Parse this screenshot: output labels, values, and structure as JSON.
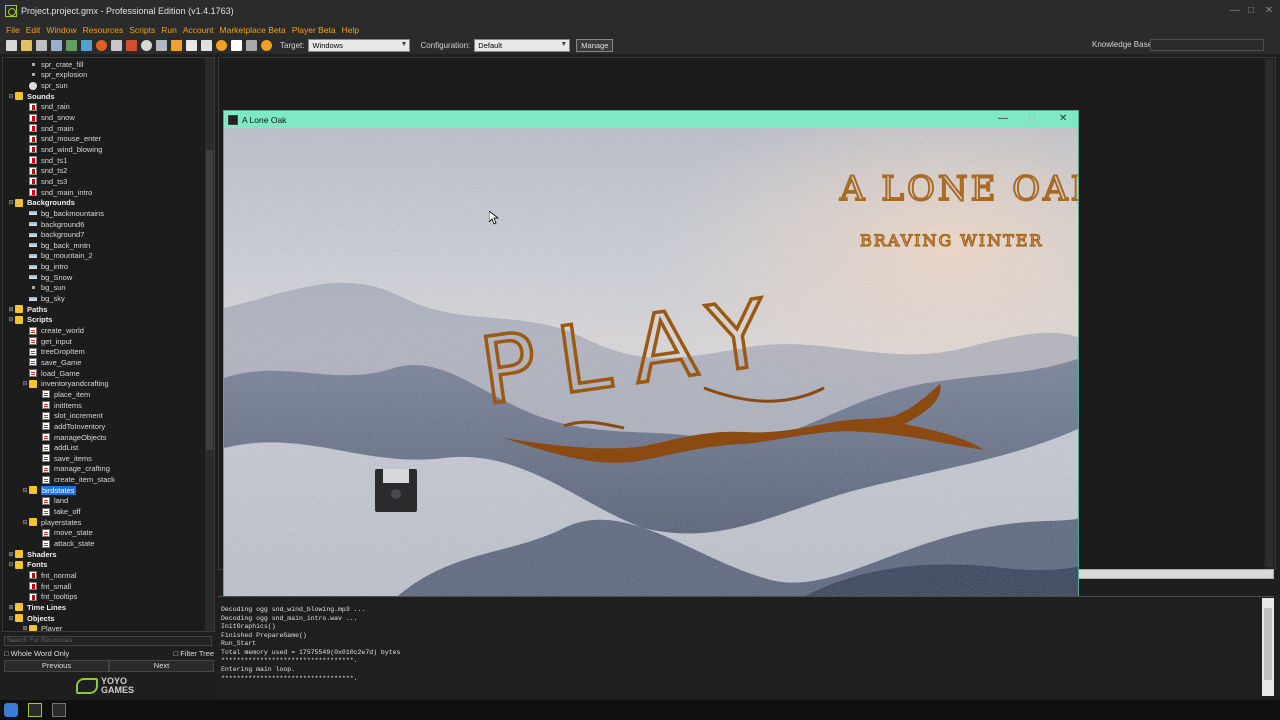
{
  "window": {
    "title": "Project.project.gmx  -  Professional Edition (v1.4.1763)"
  },
  "menu": [
    "File",
    "Edit",
    "Window",
    "Resources",
    "Scripts",
    "Run",
    "Account",
    "Marketplace Beta",
    "Player Beta",
    "Help"
  ],
  "toolbar": {
    "target_label": "Target:",
    "target_value": "Windows",
    "config_label": "Configuration:",
    "config_value": "Default",
    "manage_label": "Manage",
    "kb_label": "Knowledge Base:"
  },
  "tree": [
    {
      "label": "spr_crate_fill",
      "level": 2,
      "icon": "dot",
      "group": false
    },
    {
      "label": "spr_explosion",
      "level": 2,
      "icon": "dot",
      "group": false
    },
    {
      "label": "spr_sun",
      "level": 2,
      "icon": "spr",
      "group": false
    },
    {
      "label": "Sounds",
      "level": 1,
      "icon": "folder",
      "group": true,
      "expanded": true
    },
    {
      "label": "snd_rain",
      "level": 2,
      "icon": "snd",
      "group": false
    },
    {
      "label": "snd_snow",
      "level": 2,
      "icon": "snd",
      "group": false
    },
    {
      "label": "snd_main",
      "level": 2,
      "icon": "snd",
      "group": false
    },
    {
      "label": "snd_mouse_enter",
      "level": 2,
      "icon": "snd",
      "group": false
    },
    {
      "label": "snd_wind_blowing",
      "level": 2,
      "icon": "snd",
      "group": false
    },
    {
      "label": "snd_ts1",
      "level": 2,
      "icon": "snd",
      "group": false
    },
    {
      "label": "snd_ts2",
      "level": 2,
      "icon": "snd",
      "group": false
    },
    {
      "label": "snd_ts3",
      "level": 2,
      "icon": "snd",
      "group": false
    },
    {
      "label": "snd_main_intro",
      "level": 2,
      "icon": "snd",
      "group": false
    },
    {
      "label": "Backgrounds",
      "level": 1,
      "icon": "folder",
      "group": true,
      "expanded": true
    },
    {
      "label": "bg_backmountains",
      "level": 2,
      "icon": "bg",
      "group": false
    },
    {
      "label": "background6",
      "level": 2,
      "icon": "bg",
      "group": false
    },
    {
      "label": "background7",
      "level": 2,
      "icon": "bg",
      "group": false
    },
    {
      "label": "bg_back_mntn",
      "level": 2,
      "icon": "bg",
      "group": false
    },
    {
      "label": "bg_mountain_2",
      "level": 2,
      "icon": "bg",
      "group": false
    },
    {
      "label": "bg_intro",
      "level": 2,
      "icon": "bg",
      "group": false
    },
    {
      "label": "bg_Snow",
      "level": 2,
      "icon": "bg",
      "group": false
    },
    {
      "label": "bg_sun",
      "level": 2,
      "icon": "dot",
      "group": false
    },
    {
      "label": "bg_sky",
      "level": 2,
      "icon": "bg",
      "group": false
    },
    {
      "label": "Paths",
      "level": 1,
      "icon": "folder",
      "group": true,
      "expanded": false
    },
    {
      "label": "Scripts",
      "level": 1,
      "icon": "folder",
      "group": true,
      "expanded": true
    },
    {
      "label": "create_world",
      "level": 2,
      "icon": "scr",
      "group": false
    },
    {
      "label": "get_input",
      "level": 2,
      "icon": "scr",
      "group": false
    },
    {
      "label": "treeDropItem",
      "level": 2,
      "icon": "scr",
      "group": false
    },
    {
      "label": "save_Game",
      "level": 2,
      "icon": "scr",
      "group": false
    },
    {
      "label": "load_Game",
      "level": 2,
      "icon": "scr",
      "group": false
    },
    {
      "label": "inventoryandcrafting",
      "level": 2,
      "icon": "folder",
      "group": false,
      "expanded": true
    },
    {
      "label": "place_item",
      "level": 3,
      "icon": "scr",
      "group": false
    },
    {
      "label": "initItems",
      "level": 3,
      "icon": "scr",
      "group": false
    },
    {
      "label": "slot_increment",
      "level": 3,
      "icon": "scr",
      "group": false
    },
    {
      "label": "addToInventory",
      "level": 3,
      "icon": "scr",
      "group": false
    },
    {
      "label": "manageObjects",
      "level": 3,
      "icon": "scr",
      "group": false
    },
    {
      "label": "addList",
      "level": 3,
      "icon": "scr",
      "group": false
    },
    {
      "label": "save_items",
      "level": 3,
      "icon": "scr",
      "group": false
    },
    {
      "label": "manage_crafting",
      "level": 3,
      "icon": "scr",
      "group": false
    },
    {
      "label": "create_item_stack",
      "level": 3,
      "icon": "scr",
      "group": false
    },
    {
      "label": "birdstates",
      "level": 2,
      "icon": "folder",
      "group": false,
      "expanded": true,
      "selected": true
    },
    {
      "label": "land",
      "level": 3,
      "icon": "scr",
      "group": false
    },
    {
      "label": "take_off",
      "level": 3,
      "icon": "scr",
      "group": false
    },
    {
      "label": "playerstates",
      "level": 2,
      "icon": "folder",
      "group": false,
      "expanded": true
    },
    {
      "label": "move_state",
      "level": 3,
      "icon": "scr",
      "group": false
    },
    {
      "label": "attack_state",
      "level": 3,
      "icon": "scr",
      "group": false
    },
    {
      "label": "Shaders",
      "level": 1,
      "icon": "folder",
      "group": true,
      "expanded": false
    },
    {
      "label": "Fonts",
      "level": 1,
      "icon": "folder",
      "group": true,
      "expanded": true
    },
    {
      "label": "fnt_normal",
      "level": 2,
      "icon": "font",
      "group": false
    },
    {
      "label": "fnt_small",
      "level": 2,
      "icon": "font",
      "group": false
    },
    {
      "label": "fnt_tooltips",
      "level": 2,
      "icon": "font",
      "group": false
    },
    {
      "label": "Time Lines",
      "level": 1,
      "icon": "folder",
      "group": true,
      "expanded": false
    },
    {
      "label": "Objects",
      "level": 1,
      "icon": "folder",
      "group": true,
      "expanded": true
    },
    {
      "label": "Player",
      "level": 2,
      "icon": "folder",
      "group": false,
      "expanded": false
    }
  ],
  "search": {
    "placeholder": "Search For Resources",
    "whole_word": "Whole Word Only",
    "filter_tree": "Filter Tree",
    "previous": "Previous",
    "next": "Next"
  },
  "brand": {
    "line1": "YOYO",
    "line2": "GAMES"
  },
  "game": {
    "title": "A Lone Oak",
    "logo_line1": "A LONE OAK",
    "logo_line2": "BRAVING WINTER",
    "play_label": "PLAY"
  },
  "output": [
    "Decoding ogg snd_wind_blowing.mp3 ...",
    "Decoding ogg snd_main_intro.wav ...",
    "InitGraphics()",
    "Finished PrepareGame()",
    "Run_Start",
    "Total memory used = 17575549(0x010c2e7d) bytes",
    "**********************************.",
    "Entering main loop.",
    "**********************************."
  ],
  "colors": {
    "menu": "#f0a020",
    "game_titlebar": "#7fe8c4",
    "selection": "#1e6fd9",
    "paint": "#9a5a14"
  }
}
